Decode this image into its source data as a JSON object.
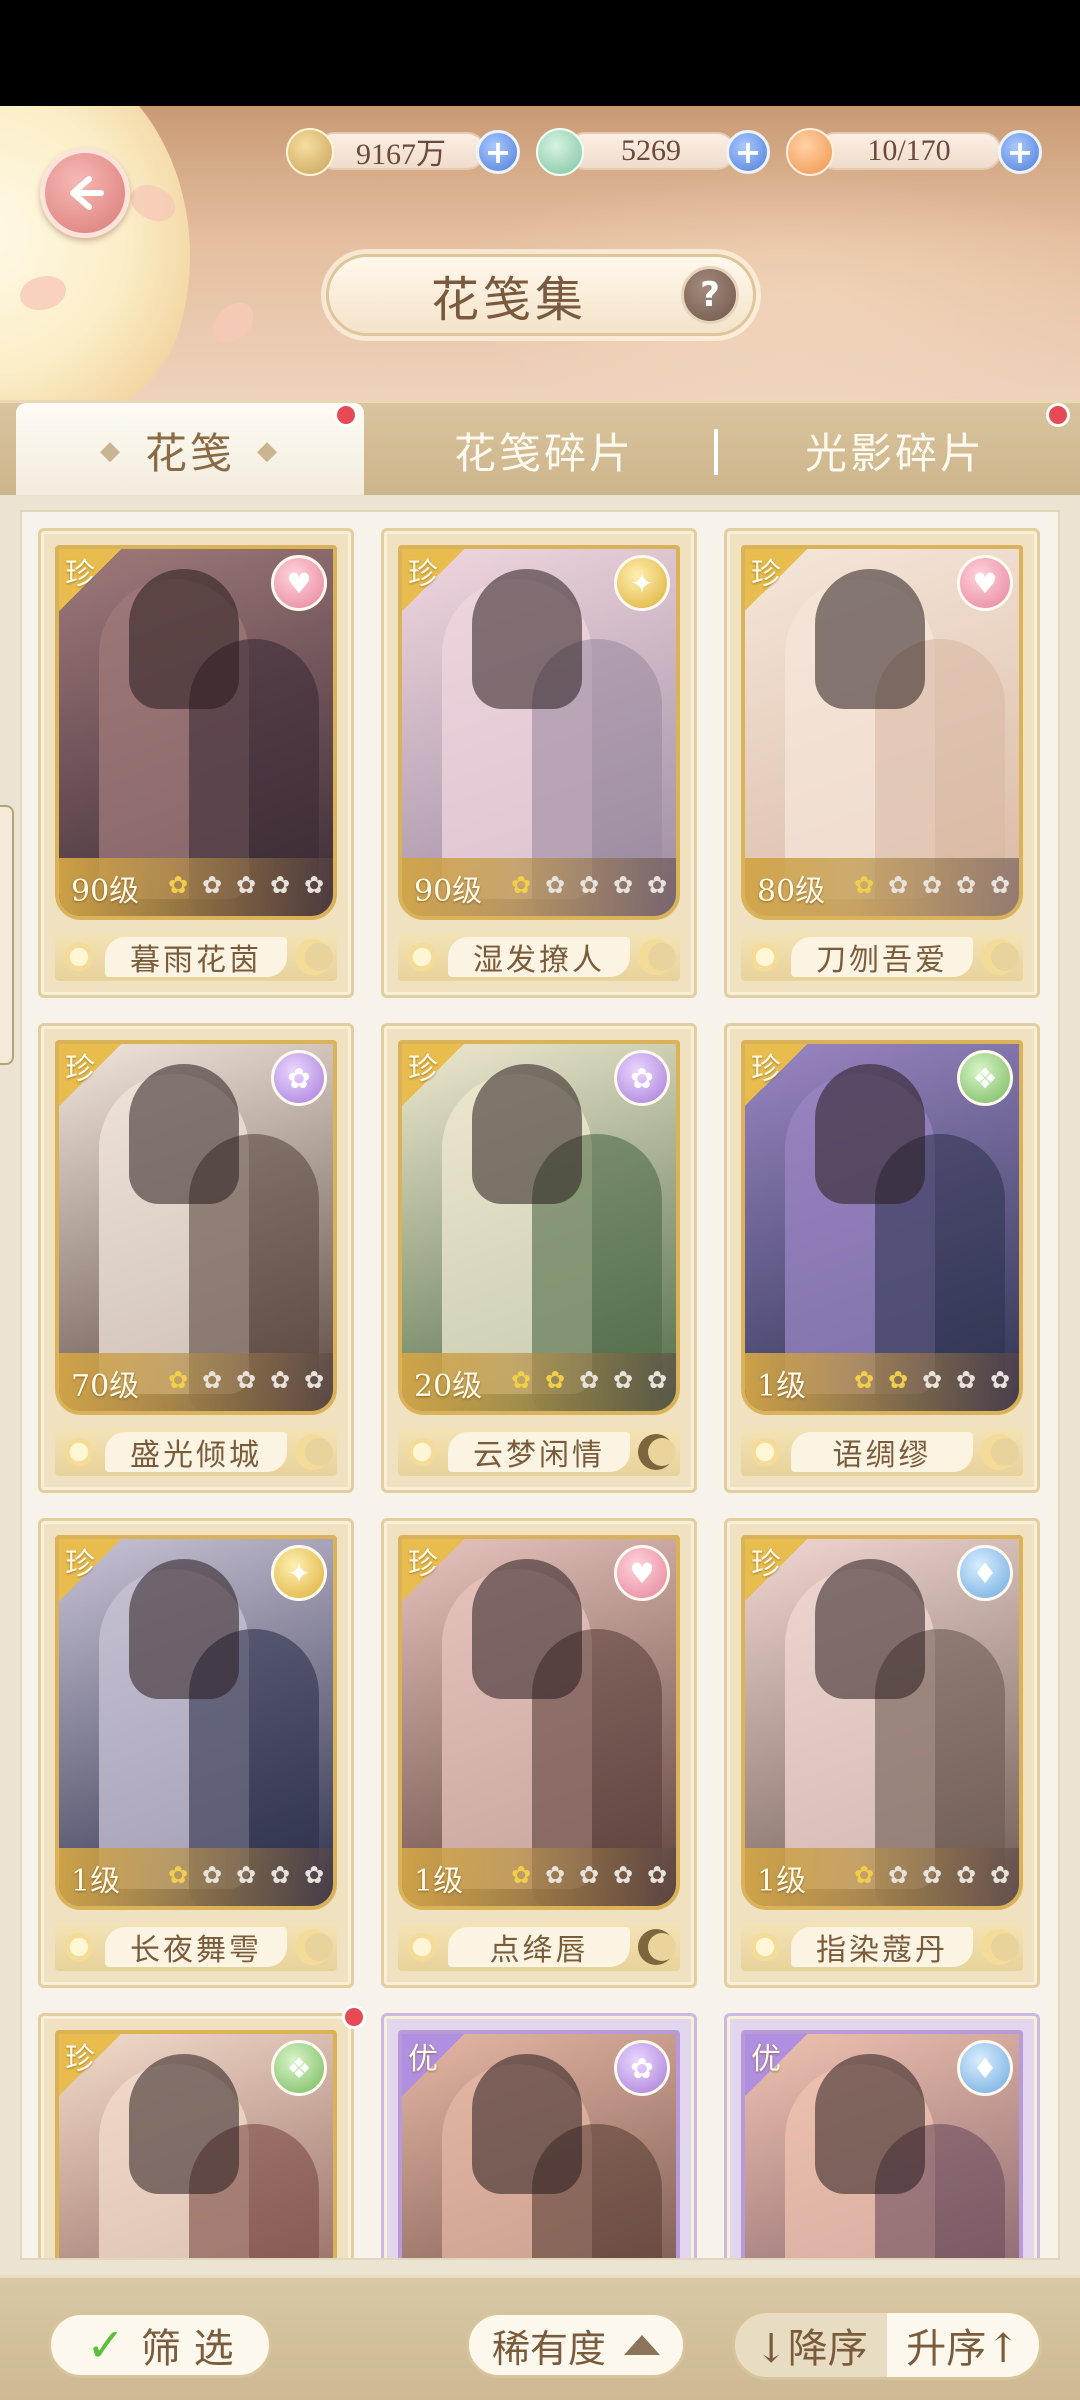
{
  "header": {
    "title": "花笺集",
    "help_label": "?",
    "currencies": [
      {
        "name": "paw-coin-icon",
        "value": "9167万",
        "color": "#c9a15a"
      },
      {
        "name": "jade-icon",
        "value": "5269",
        "color": "#7fc3a0"
      },
      {
        "name": "pastry-icon",
        "value": "10/170",
        "color": "#f0944a"
      }
    ],
    "plus_label": "+"
  },
  "tabs": [
    {
      "label": "花笺",
      "active": true
    },
    {
      "label": "花笺碎片",
      "active": false
    },
    {
      "label": "光影碎片",
      "active": false
    }
  ],
  "cards": [
    {
      "rarity": "珍",
      "level": "90级",
      "stars": 1,
      "name": "暮雨花茵",
      "attr": "heart",
      "palette": [
        "#3a2a35",
        "#a07a7a"
      ]
    },
    {
      "rarity": "珍",
      "level": "90级",
      "stars": 1,
      "name": "湿发撩人",
      "attr": "wing",
      "palette": [
        "#9b8aa0",
        "#f0d6de"
      ]
    },
    {
      "rarity": "珍",
      "level": "80级",
      "stars": 1,
      "name": "刀刎吾爱",
      "attr": "heart",
      "palette": [
        "#d9b9a3",
        "#f5e6da"
      ]
    },
    {
      "rarity": "珍",
      "level": "70级",
      "stars": 1,
      "name": "盛光倾城",
      "attr": "lotus",
      "palette": [
        "#5a4740",
        "#f2e6dc"
      ]
    },
    {
      "rarity": "珍",
      "level": "20级",
      "stars": 2,
      "name": "云梦闲情",
      "attr": "lotus",
      "palette": [
        "#4f6b45",
        "#efe9d0"
      ]
    },
    {
      "rarity": "珍",
      "level": "1级",
      "stars": 2,
      "name": "语绸缪",
      "attr": "leaf",
      "palette": [
        "#2e3350",
        "#9a86c4"
      ]
    },
    {
      "rarity": "珍",
      "level": "1级",
      "stars": 1,
      "name": "长夜舞雩",
      "attr": "wing",
      "palette": [
        "#2c2f4a",
        "#c9c3d6"
      ]
    },
    {
      "rarity": "珍",
      "level": "1级",
      "stars": 1,
      "name": "点绛唇",
      "attr": "heart",
      "palette": [
        "#5c403a",
        "#e8c4bd"
      ]
    },
    {
      "rarity": "珍",
      "level": "1级",
      "stars": 1,
      "name": "指染蔻丹",
      "attr": "drop",
      "palette": [
        "#6d5a52",
        "#f1d7d2"
      ]
    },
    {
      "rarity": "珍",
      "attr": "leaf",
      "palette": [
        "#7a4a45",
        "#f3dccb"
      ]
    },
    {
      "rarity": "优",
      "attr": "lotus",
      "palette": [
        "#5a3e36",
        "#e6b7a5"
      ]
    },
    {
      "rarity": "优",
      "attr": "drop",
      "palette": [
        "#6a4b5c",
        "#f0c3b0"
      ]
    }
  ],
  "bottom": {
    "filter_label": "筛 选",
    "sort_label": "稀有度",
    "desc_label": "↓降序",
    "asc_label": "升序↑"
  }
}
